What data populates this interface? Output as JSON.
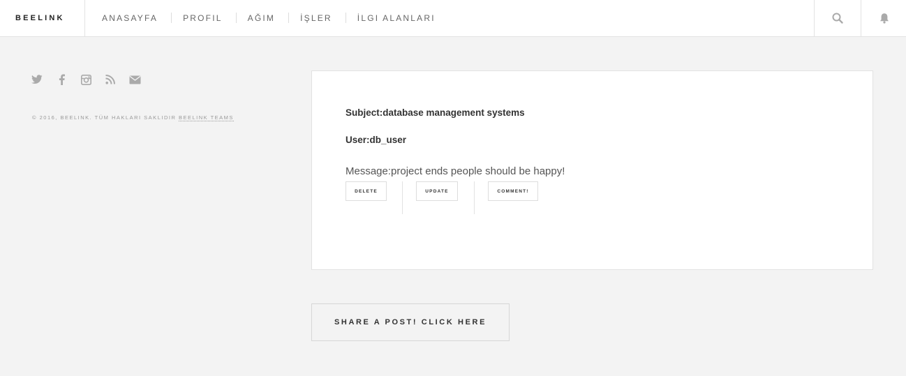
{
  "brand": {
    "logo": "BEELINK"
  },
  "nav": {
    "items": [
      {
        "label": "ANASAYFA"
      },
      {
        "label": "PROFIL"
      },
      {
        "label": "AĞIM"
      },
      {
        "label": "İŞLER"
      },
      {
        "label": "İLGI ALANLARI"
      }
    ]
  },
  "header_icons": [
    "search-icon",
    "bell-icon"
  ],
  "social_icons": [
    "twitter-icon",
    "facebook-icon",
    "instagram-icon",
    "rss-icon",
    "mail-icon"
  ],
  "footer": {
    "copyright": "© 2016, BEELINK. TÜM HAKLARI SAKLIDIR",
    "team_link": "BEELINK TEAMS"
  },
  "post": {
    "subject": "Subject:database management systems",
    "user": "User:db_user",
    "message": "Message:project ends people should be happy!",
    "actions": {
      "delete": "DELETE",
      "update": "UPDATE",
      "comment": "COMMENT!"
    }
  },
  "share_button": "SHARE A POST! CLICK HERE",
  "colors": {
    "background": "#f3f3f3",
    "card": "#ffffff",
    "text": "#333333",
    "muted": "#999999",
    "border": "#e2e2e2"
  }
}
